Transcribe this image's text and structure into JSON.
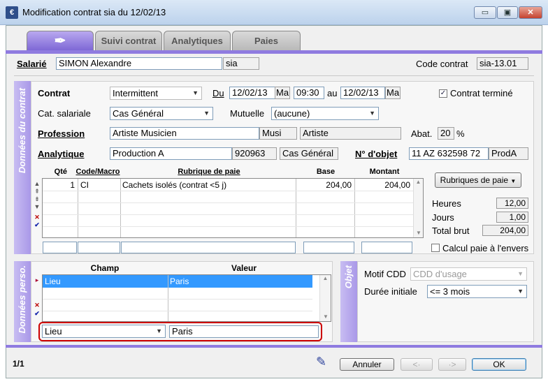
{
  "window": {
    "title": "Modification contrat sia du 12/02/13",
    "min": "▭",
    "max": "▣",
    "close": "✕"
  },
  "tabs": [
    {
      "label": ""
    },
    {
      "label": "Suivi contrat"
    },
    {
      "label": "Analytiques"
    },
    {
      "label": "Paies"
    }
  ],
  "salarie": {
    "label": "Salarié",
    "name": "SIMON Alexandre",
    "code": "sia",
    "code_contrat_label": "Code contrat",
    "code_contrat": "sia-13.01"
  },
  "donnees": {
    "side_label": "Données du contrat",
    "contrat_label": "Contrat",
    "contrat_value": "Intermittent",
    "du_label": "Du",
    "du_date": "12/02/13",
    "du_day": "Ma",
    "du_time": "09:30",
    "au_label": "au",
    "au_date": "12/02/13",
    "au_day": "Ma",
    "termine_label": "Contrat terminé",
    "termine_check": "✓",
    "cat_label": "Cat. salariale",
    "cat_value": "Cas Général",
    "mutuelle_label": "Mutuelle",
    "mutuelle_value": "(aucune)",
    "profession_label": "Profession",
    "profession_value": "Artiste Musicien",
    "profession_code": "Musi",
    "profession_cat": "Artiste",
    "abat_label": "Abat.",
    "abat_value": "20",
    "abat_unit": "%",
    "analytique_label": "Analytique",
    "analytique_value": "Production A",
    "analytique_code": "920963",
    "analytique_cat": "Cas Général",
    "objet_label": "N° d'objet",
    "objet_value": "11 AZ 632598 72",
    "objet_code": "ProdA"
  },
  "paie_grid": {
    "headers": {
      "qte": "Qté",
      "code": "Code/Macro",
      "rubrique": "Rubrique de paie",
      "base": "Base",
      "montant": "Montant"
    },
    "rows": [
      {
        "qte": "1",
        "code": "CI",
        "rubrique": "Cachets isolés (contrat <5 j)",
        "base": "204,00",
        "montant": "204,00"
      }
    ],
    "rubriques_button": "Rubriques de paie",
    "heures_label": "Heures",
    "heures_value": "12,00",
    "jours_label": "Jours",
    "jours_value": "1,00",
    "total_label": "Total brut",
    "total_value": "204,00",
    "envers_label": "Calcul paie à l'envers"
  },
  "perso": {
    "side_label": "Données perso.",
    "headers": {
      "champ": "Champ",
      "valeur": "Valeur"
    },
    "rows": [
      {
        "champ": "Lieu",
        "valeur": "Paris"
      }
    ],
    "edit_champ": "Lieu",
    "edit_valeur": "Paris"
  },
  "objet_panel": {
    "side_label": "Objet",
    "motif_label": "Motif CDD",
    "motif_value": "CDD d'usage",
    "duree_label": "Durée initiale",
    "duree_value": "<= 3 mois"
  },
  "footer": {
    "page": "1/1",
    "annuler": "Annuler",
    "prev": "<·",
    "next": "·>",
    "ok": "OK"
  },
  "colors": {
    "accent": "#8f7be0",
    "highlight": "#3399ff",
    "focus_border": "#cc0000"
  }
}
